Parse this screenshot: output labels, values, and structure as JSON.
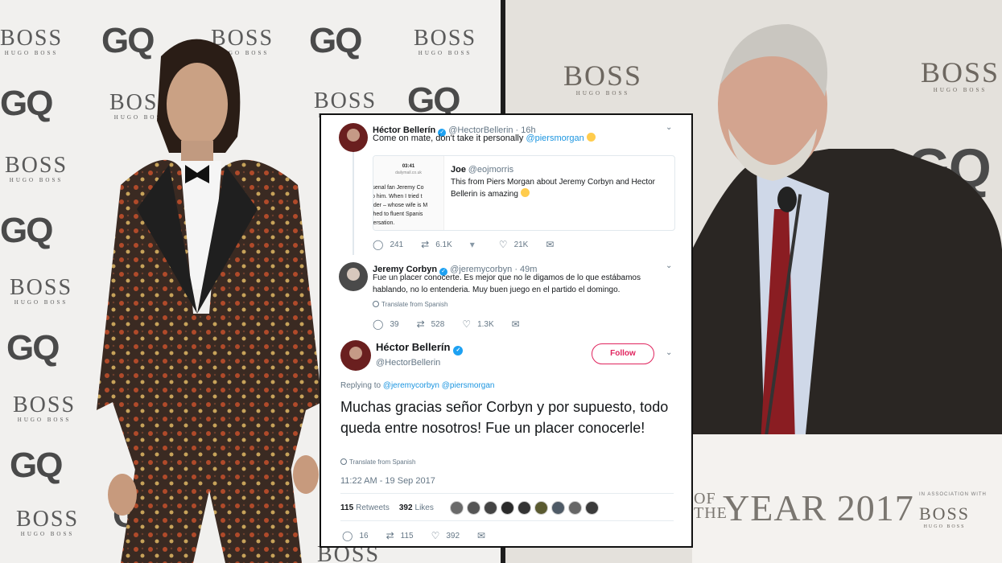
{
  "background": {
    "wall_logos": {
      "gq": "GQ",
      "boss": "BOSS",
      "hugo_boss": "HUGO BOSS"
    },
    "podium": {
      "of_text": "OF THE",
      "year_text": "YEAR 2017",
      "association_text": "IN ASSOCIATION WITH",
      "boss": "BOSS",
      "hugo_boss": "HUGO BOSS"
    }
  },
  "thread": {
    "tweet1": {
      "name": "Héctor Bellerín",
      "handle": "@HectorBellerin · 16h",
      "text": "Come on mate, don't take it personally",
      "mention": "@piersmorgan",
      "quote": {
        "thumb_time": "03:41",
        "thumb_site": "dailymail.co.uk",
        "thumb_lines": [
          "rsenal fan Jeremy Co",
          "to him. When I tried t",
          "ader – whose wife is M",
          "ched to fluent Spanis",
          "versation."
        ],
        "name": "Joe",
        "handle": "@eojmorris",
        "text": "This from Piers Morgan about Jeremy Corbyn and Hector Bellerin is amazing"
      },
      "actions": {
        "replies": "241",
        "retweets": "6.1K",
        "likes": "21K"
      }
    },
    "tweet2": {
      "name": "Jeremy Corbyn",
      "handle": "@jeremycorbyn · 49m",
      "text": "Fue un placer conocerte. Es mejor que no le digamos de lo que estábamos hablando, no lo entenderia. Muy buen juego en el partido el domingo.",
      "translate": "Translate from Spanish",
      "actions": {
        "replies": "39",
        "retweets": "528",
        "likes": "1.3K"
      }
    },
    "main": {
      "name": "Héctor Bellerín",
      "handle": "@HectorBellerin",
      "follow_label": "Follow",
      "replying_to_label": "Replying to",
      "replying_to": "@jeremycorbyn @piersmorgan",
      "text": "Muchas gracias señor Corbyn y por supuesto, todo queda entre nosotros! Fue un placer conocerle!",
      "translate": "Translate from Spanish",
      "timestamp": "11:22 AM - 19 Sep 2017",
      "retweets_count": "115",
      "retweets_label": "Retweets",
      "likes_count": "392",
      "likes_label": "Likes",
      "actions": {
        "replies": "16",
        "retweets": "115",
        "likes": "392"
      }
    }
  },
  "colors": {
    "link": "#1b95e0",
    "verified": "#1da1f2",
    "follow": "#e0245e",
    "muted": "#657786"
  }
}
